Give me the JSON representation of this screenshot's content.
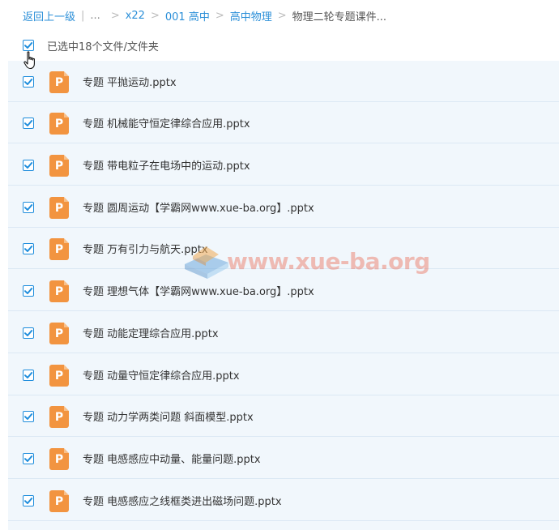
{
  "breadcrumb": {
    "back": "返回上一级",
    "divider": "|",
    "ellipsis": "...",
    "items": [
      "x22",
      "001 高中",
      "高中物理"
    ],
    "current": "物理二轮专题课件..."
  },
  "selection": {
    "label": "已选中18个文件/文件夹",
    "checked": true
  },
  "files": [
    {
      "name": "专题 平抛运动.pptx",
      "checked": true,
      "icon": "ppt-file-icon"
    },
    {
      "name": "专题 机械能守恒定律综合应用.pptx",
      "checked": true,
      "icon": "ppt-file-icon"
    },
    {
      "name": "专题 带电粒子在电场中的运动.pptx",
      "checked": true,
      "icon": "ppt-file-icon"
    },
    {
      "name": "专题 圆周运动【学霸网www.xue-ba.org】.pptx",
      "checked": true,
      "icon": "ppt-file-icon"
    },
    {
      "name": "专题 万有引力与航天.pptx",
      "checked": true,
      "icon": "ppt-file-icon"
    },
    {
      "name": "专题 理想气体【学霸网www.xue-ba.org】.pptx",
      "checked": true,
      "icon": "ppt-file-icon"
    },
    {
      "name": "专题 动能定理综合应用.pptx",
      "checked": true,
      "icon": "ppt-file-icon"
    },
    {
      "name": "专题 动量守恒定律综合应用.pptx",
      "checked": true,
      "icon": "ppt-file-icon"
    },
    {
      "name": "专题 动力学两类问题 斜面模型.pptx",
      "checked": true,
      "icon": "ppt-file-icon"
    },
    {
      "name": "专题 电感感应中动量、能量问题.pptx",
      "checked": true,
      "icon": "ppt-file-icon"
    },
    {
      "name": "专题 电感感应之线框类进出磁场问题.pptx",
      "checked": true,
      "icon": "ppt-file-icon"
    }
  ],
  "icon_letter": "P",
  "watermark": {
    "text": "www.xue-ba.org"
  },
  "colors": {
    "link": "#2b8fd8",
    "checkbox": "#1e8ddc",
    "ppt_icon": "#f29440",
    "row_bg": "#f1f7fc"
  }
}
